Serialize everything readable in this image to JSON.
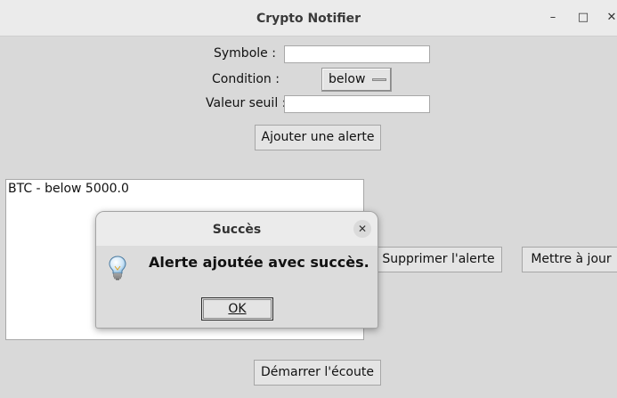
{
  "window": {
    "title": "Crypto Notifier",
    "controls": {
      "minimize": "–",
      "maximize": "□",
      "close": "✕"
    }
  },
  "form": {
    "symbol_label": "Symbole :",
    "symbol_value": "",
    "condition_label": "Condition :",
    "condition_value": "below",
    "threshold_label": "Valeur seuil :",
    "threshold_value": "",
    "add_button": "Ajouter une alerte"
  },
  "alerts": {
    "items": [
      "BTC - below 5000.0"
    ]
  },
  "actions": {
    "delete_button": "Supprimer l'alerte",
    "update_button": "Mettre à jour",
    "start_button": "Démarrer l'écoute"
  },
  "dialog": {
    "title": "Succès",
    "message": "Alerte ajoutée avec succès.",
    "ok_button": "OK",
    "icon": "lightbulb-icon",
    "close": "✕"
  }
}
